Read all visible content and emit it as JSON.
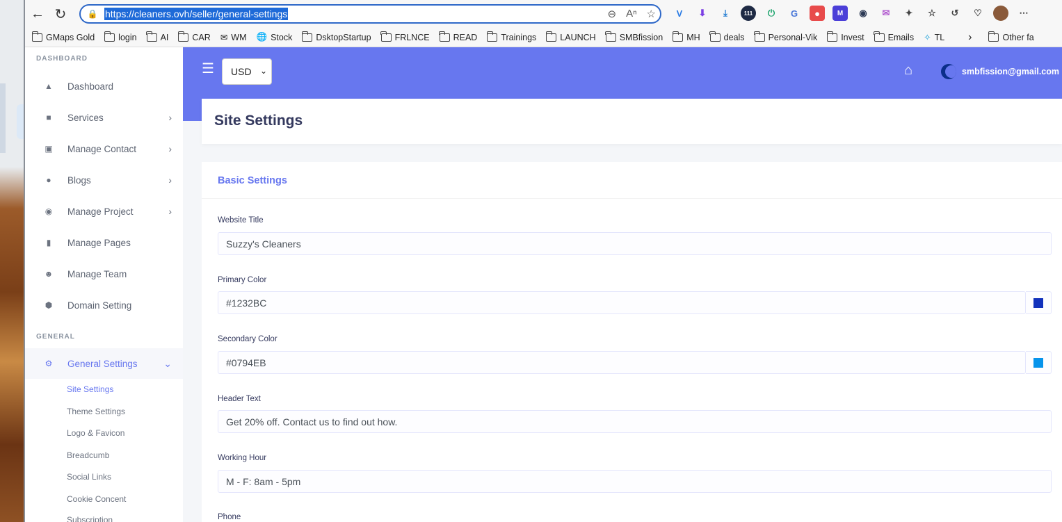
{
  "browser": {
    "url": "https://cleaners.ovh/seller/general-settings",
    "bookmarks": [
      "GMaps Gold",
      "login",
      "AI",
      "CAR",
      "WM",
      "Stock",
      "DsktopStartup",
      "FRLNCE",
      "READ",
      "Trainings",
      "LAUNCH",
      "SMBfission",
      "MH",
      "deals",
      "Personal-Vik",
      "Invest",
      "Emails",
      "TL",
      "Other fa"
    ],
    "extension_badge": "111"
  },
  "header": {
    "currency": "USD",
    "user_email": "smbfission@gmail.com"
  },
  "sidebar": {
    "section_dashboard": "DASHBOARD",
    "section_general": "GENERAL",
    "items": [
      {
        "label": "Dashboard",
        "icon": "fire-icon"
      },
      {
        "label": "Services",
        "icon": "briefcase-icon"
      },
      {
        "label": "Manage Contact",
        "icon": "contact-icon"
      },
      {
        "label": "Blogs",
        "icon": "blog-icon"
      },
      {
        "label": "Manage Project",
        "icon": "project-icon"
      },
      {
        "label": "Manage Pages",
        "icon": "page-icon"
      },
      {
        "label": "Manage Team",
        "icon": "team-icon"
      },
      {
        "label": "Domain Setting",
        "icon": "domain-icon"
      }
    ],
    "general_settings": "General Settings",
    "sub_items": [
      "Site Settings",
      "Theme Settings",
      "Logo & Favicon",
      "Breadcumb",
      "Social Links",
      "Cookie Concent",
      "Subscription"
    ]
  },
  "main": {
    "page_title": "Site Settings",
    "card_title": "Basic Settings",
    "fields": {
      "website_title_label": "Website Title",
      "website_title_value": "Suzzy's Cleaners",
      "primary_color_label": "Primary Color",
      "primary_color_value": "#1232BC",
      "secondary_color_label": "Secondary Color",
      "secondary_color_value": "#0794EB",
      "header_text_label": "Header Text",
      "header_text_value": "Get 20% off. Contact us to find out how.",
      "working_hour_label": "Working Hour",
      "working_hour_value": "M - F: 8am - 5pm",
      "phone_label": "Phone"
    }
  },
  "colors": {
    "accent": "#6777ef",
    "primary_swatch": "#1232BC",
    "secondary_swatch": "#0794EB"
  }
}
